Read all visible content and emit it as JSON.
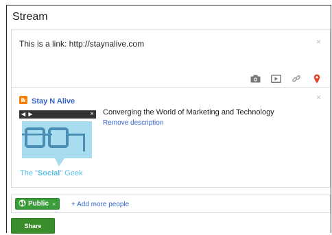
{
  "header": {
    "title": "Stream"
  },
  "composer": {
    "text": "This is a link: http://staynalive.com",
    "close_glyph": "×",
    "tools": [
      "camera-icon",
      "video-icon",
      "link-icon",
      "location-pin-icon"
    ]
  },
  "link_preview": {
    "source_name": "Stay N Alive",
    "title": "Converging the World of Marketing and Technology",
    "remove_label": "Remove description",
    "thumbnail": {
      "nav": "◀ ▶",
      "close": "×",
      "caption_pre": "The \"",
      "caption_bold": "Social",
      "caption_post": "\" Geek"
    },
    "close_glyph": "×"
  },
  "audience": {
    "chip_label": "Public",
    "chip_close": "×",
    "add_label": "+ Add more people"
  },
  "actions": {
    "share_label": "Share"
  },
  "colors": {
    "link": "#3366cc",
    "chip_green": "#3b9c3b",
    "share_green": "#3a8d2a",
    "blogger_orange": "#f57d00",
    "thumb_blue": "#5bbde6"
  }
}
